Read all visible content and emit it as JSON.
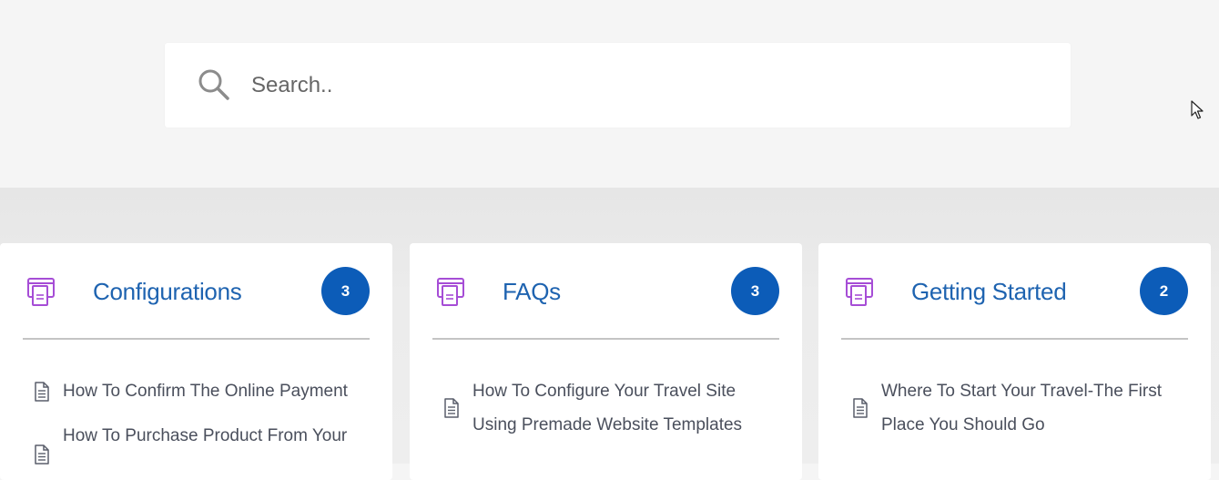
{
  "search": {
    "placeholder": "Search.."
  },
  "cards": [
    {
      "title": "Configurations",
      "count": "3",
      "articles": [
        "How To Confirm The Online Payment",
        "How To Purchase Product From Your"
      ]
    },
    {
      "title": "FAQs",
      "count": "3",
      "articles": [
        "How To Configure Your Travel Site Using Premade Website Templates"
      ]
    },
    {
      "title": "Getting Started",
      "count": "2",
      "articles": [
        "Where To Start Your Travel-The First Place You Should Go"
      ]
    }
  ],
  "colors": {
    "accent": "#1e63b0",
    "badge": "#0c5cb8",
    "icon": "#a64dd6"
  },
  "icons": {
    "search": "search-icon",
    "category": "folder-document-icon",
    "article": "document-icon",
    "pointer": "mouse-cursor-icon"
  }
}
